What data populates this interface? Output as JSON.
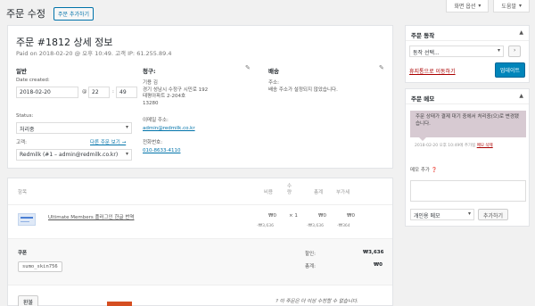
{
  "header": {
    "title": "주문 수정",
    "add_order": "주문 추가하기",
    "screen_options": "화면 옵션",
    "help": "도움말"
  },
  "order": {
    "heading": "주문 #1812 상세 정보",
    "paid_line": "Paid on 2018-02-20 @ 오후 10:49. 고객 IP: 61.255.89.4",
    "general": {
      "title": "일반",
      "date_label": "Date created:",
      "date": "2018-02-20",
      "at": "@",
      "hour": "22",
      "colon": ":",
      "minute": "49",
      "status_label": "Status:",
      "status": "처리중",
      "customer_label": "고객:",
      "other_orders": "다른 주문 보기 →",
      "customer": "Redmilk (#1 – admin@redmilk.co.kr)"
    },
    "billing": {
      "title": "청구:",
      "lines": [
        "기용 김",
        "경기 성남시 수정구 시민로 192",
        "태평아파트 2-204호",
        "13280"
      ],
      "email_label": "이메일 주소:",
      "email": "admin@redmilk.co.kr",
      "phone_label": "전화번호:",
      "phone": "010-8633-4110"
    },
    "shipping": {
      "title": "배송",
      "address_label": "주소:",
      "address": "배송 주소가 설정되지 않았습니다."
    }
  },
  "items": {
    "columns": {
      "item": "항목",
      "cost": "비용",
      "qty": "수량",
      "total": "총계",
      "tax": "부가세"
    },
    "row": {
      "name": "Ultimate Members 플러그인 한글 번역",
      "cost": "₩0",
      "cost_sub": "-₩3,636",
      "qty": "× 1",
      "total": "₩0",
      "total_sub": "-₩3,636",
      "tax": "₩0",
      "tax_sub": "-₩364"
    },
    "coupon_label": "쿠폰",
    "coupon_code": "sumo_skin756",
    "discount_label": "할인:",
    "discount_value": "₩3,636",
    "total_label": "총계:",
    "total_value": "₩0",
    "refund_button": "환불",
    "notice": "이 주문은 더 이상 수정할 수 없습니다."
  },
  "sidebar": {
    "actions": {
      "title": "주문 동작",
      "select": "동작 선택...",
      "trash": "휴지통으로 이동하기",
      "update": "업데이트"
    },
    "notes": {
      "title": "주문 메모",
      "note_text": "주문 상태가 결제 대기 중에서 처리중(으)로 변경됐습니다.",
      "note_meta": "2018-02-20 오후 10:49에 추가됨",
      "delete": "메모 삭제",
      "add_label": "메모 추가",
      "type": "개인용 메모",
      "add_button": "추가하기"
    }
  }
}
